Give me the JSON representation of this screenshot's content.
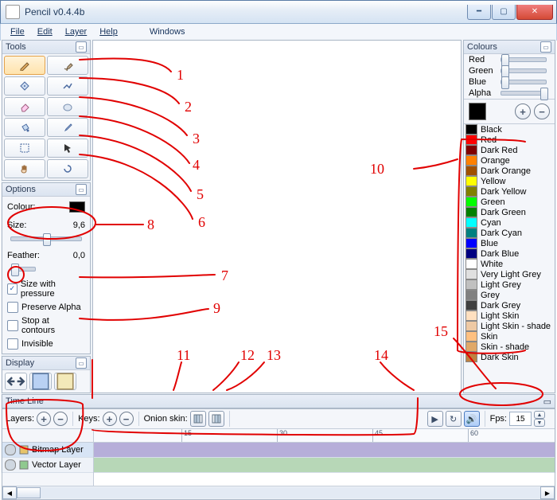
{
  "window": {
    "title": "Pencil v0.4.4b"
  },
  "menu": {
    "file": "File",
    "edit": "Edit",
    "layer": "Layer",
    "help": "Help",
    "windows": "Windows"
  },
  "panels": {
    "tools": "Tools",
    "options": "Options",
    "display": "Display",
    "colours": "Colours",
    "timeline": "Time Line"
  },
  "tools": [
    {
      "name": "pencil-tool",
      "icon": "pencil",
      "selected": true
    },
    {
      "name": "brush-tool",
      "icon": "brush"
    },
    {
      "name": "pen-tool",
      "icon": "pen"
    },
    {
      "name": "polyline-tool",
      "icon": "polyline"
    },
    {
      "name": "eraser-tool",
      "icon": "eraser"
    },
    {
      "name": "smudge-tool",
      "icon": "blob"
    },
    {
      "name": "bucket-tool",
      "icon": "bucket"
    },
    {
      "name": "eyedropper-tool",
      "icon": "eyedropper"
    },
    {
      "name": "select-tool",
      "icon": "dashed"
    },
    {
      "name": "move-tool",
      "icon": "cursor"
    },
    {
      "name": "hand-tool",
      "icon": "hand"
    },
    {
      "name": "zoom-tool",
      "icon": "swirl"
    }
  ],
  "options": {
    "colour_label": "Colour:",
    "size_label": "Size:",
    "size_value": "9,6",
    "feather_label": "Feather:",
    "feather_value": "0,0",
    "pressure": "Size with pressure",
    "pressure_checked": true,
    "preserve": "Preserve Alpha",
    "preserve_checked": false,
    "contours": "Stop at contours",
    "contours_checked": false,
    "invisible": "Invisible",
    "invisible_checked": false
  },
  "colours": {
    "red": "Red",
    "green": "Green",
    "blue": "Blue",
    "alpha": "Alpha",
    "current": "#000000",
    "palette": [
      {
        "name": "Black",
        "hex": "#000000"
      },
      {
        "name": "Red",
        "hex": "#ff0000"
      },
      {
        "name": "Dark Red",
        "hex": "#800000"
      },
      {
        "name": "Orange",
        "hex": "#ff8000"
      },
      {
        "name": "Dark Orange",
        "hex": "#a05000"
      },
      {
        "name": "Yellow",
        "hex": "#ffff00"
      },
      {
        "name": "Dark Yellow",
        "hex": "#808000"
      },
      {
        "name": "Green",
        "hex": "#00ff00"
      },
      {
        "name": "Dark Green",
        "hex": "#008000"
      },
      {
        "name": "Cyan",
        "hex": "#00ffff"
      },
      {
        "name": "Dark Cyan",
        "hex": "#008080"
      },
      {
        "name": "Blue",
        "hex": "#0000ff"
      },
      {
        "name": "Dark Blue",
        "hex": "#000080"
      },
      {
        "name": "White",
        "hex": "#ffffff"
      },
      {
        "name": "Very Light Grey",
        "hex": "#e0e0e0"
      },
      {
        "name": "Light Grey",
        "hex": "#c0c0c0"
      },
      {
        "name": "Grey",
        "hex": "#808080"
      },
      {
        "name": "Dark Grey",
        "hex": "#404040"
      },
      {
        "name": "Light Skin",
        "hex": "#ffe0c0"
      },
      {
        "name": "Light Skin - shade",
        "hex": "#eec9a4"
      },
      {
        "name": "Skin",
        "hex": "#ffc080"
      },
      {
        "name": "Skin - shade",
        "hex": "#e0a868"
      },
      {
        "name": "Dark Skin",
        "hex": "#c08040"
      }
    ]
  },
  "timeline": {
    "layers_label": "Layers:",
    "keys_label": "Keys:",
    "onion_label": "Onion skin:",
    "fps_label": "Fps:",
    "fps_value": "15",
    "ticks": [
      "15",
      "30",
      "45",
      "60"
    ],
    "layers": [
      {
        "name": "Bitmap Layer",
        "type": "bitmap"
      },
      {
        "name": "Vector Layer",
        "type": "vector"
      }
    ]
  },
  "annotations": {
    "1": "1",
    "2": "2",
    "3": "3",
    "4": "4",
    "5": "5",
    "6": "6",
    "7": "7",
    "8": "8",
    "9": "9",
    "10": "10",
    "11": "11",
    "12": "12",
    "13": "13",
    "14": "14",
    "15": "15"
  }
}
